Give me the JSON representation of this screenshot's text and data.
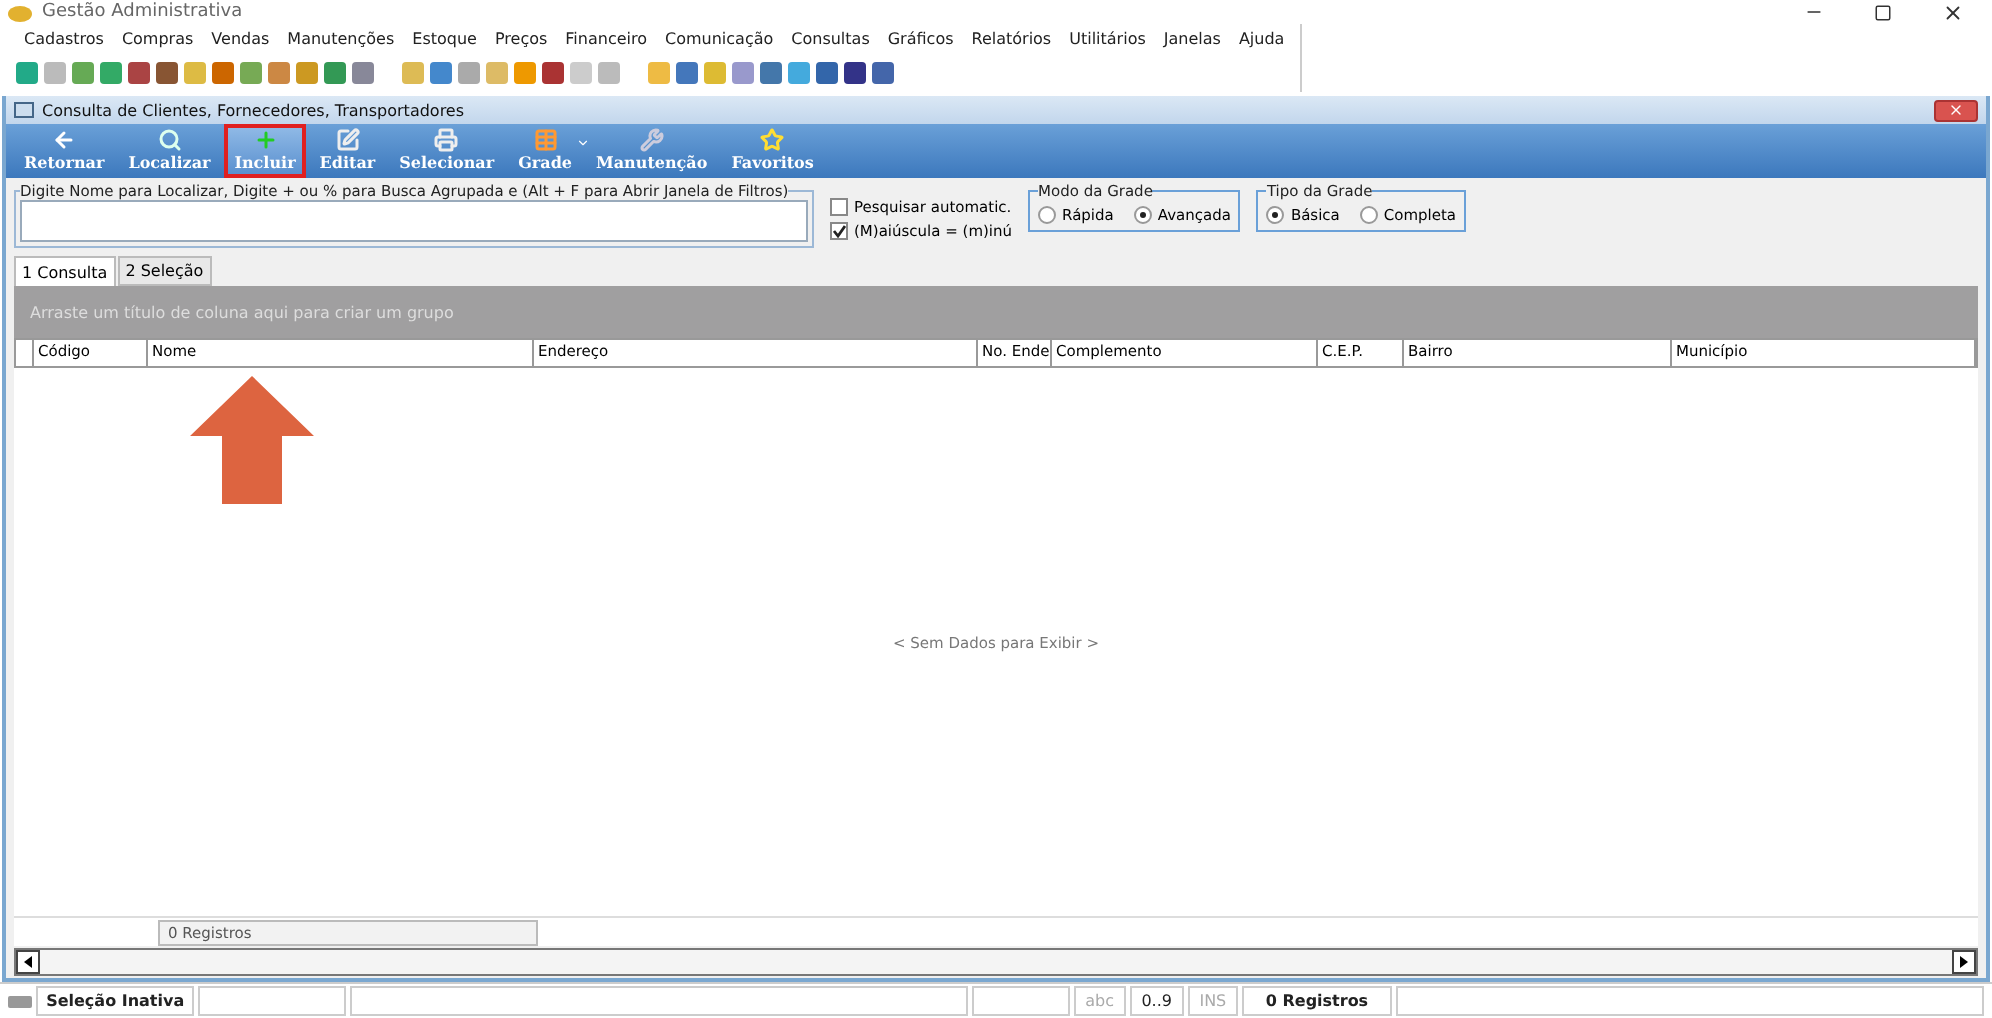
{
  "app": {
    "title": "Gestão Administrativa"
  },
  "menu": [
    "Cadastros",
    "Compras",
    "Vendas",
    "Manutenções",
    "Estoque",
    "Preços",
    "Financeiro",
    "Comunicação",
    "Consultas",
    "Gráficos",
    "Relatórios",
    "Utilitários",
    "Janelas",
    "Ajuda"
  ],
  "window": {
    "title": "Consulta de Clientes, Fornecedores, Transportadores"
  },
  "toolbar": [
    {
      "label": "Retornar",
      "highlighted": false,
      "has_menu": false
    },
    {
      "label": "Localizar",
      "highlighted": false,
      "has_menu": false
    },
    {
      "label": "Incluir",
      "highlighted": true,
      "has_menu": false
    },
    {
      "label": "Editar",
      "highlighted": false,
      "has_menu": false
    },
    {
      "label": "Selecionar",
      "highlighted": false,
      "has_menu": false
    },
    {
      "label": "Grade",
      "highlighted": false,
      "has_menu": true
    },
    {
      "label": "Manutenção",
      "highlighted": false,
      "has_menu": false
    },
    {
      "label": "Favoritos",
      "highlighted": false,
      "has_menu": false
    }
  ],
  "search": {
    "label": "Digite Nome para Localizar, Digite + ou % para Busca Agrupada e (Alt + F para Abrir Janela de Filtros)"
  },
  "options": [
    {
      "label": "Pesquisar automatic.",
      "checked": false
    },
    {
      "label": "(M)aiúscula = (m)inú",
      "checked": true
    }
  ],
  "radio_groups": [
    {
      "title": "Modo da Grade",
      "options": [
        {
          "label": "Rápida",
          "selected": false
        },
        {
          "label": "Avançada",
          "selected": true
        }
      ]
    },
    {
      "title": "Tipo da Grade",
      "options": [
        {
          "label": "Básica",
          "selected": true
        },
        {
          "label": "Completa",
          "selected": false
        }
      ]
    }
  ],
  "tabs": [
    {
      "label": "1 Consulta",
      "selected": true
    },
    {
      "label": "2 Seleção",
      "selected": false
    }
  ],
  "grid": {
    "group_hint": "Arraste um título de coluna aqui para criar um grupo",
    "columns": [
      "Código",
      "Nome",
      "Endereço",
      "No. Ende",
      "Complemento",
      "C.E.P.",
      "Bairro",
      "Município"
    ],
    "empty_text": "< Sem Dados para Exibir >",
    "footer": "0 Registros"
  },
  "status_bar": [
    {
      "text": "Seleção Inativa",
      "kind": "bold"
    },
    {
      "text": "abc",
      "kind": "dim"
    },
    {
      "text": "0..9",
      "kind": "plain"
    },
    {
      "text": "INS",
      "kind": "dim"
    },
    {
      "text": "0 Registros",
      "kind": "bold"
    }
  ]
}
